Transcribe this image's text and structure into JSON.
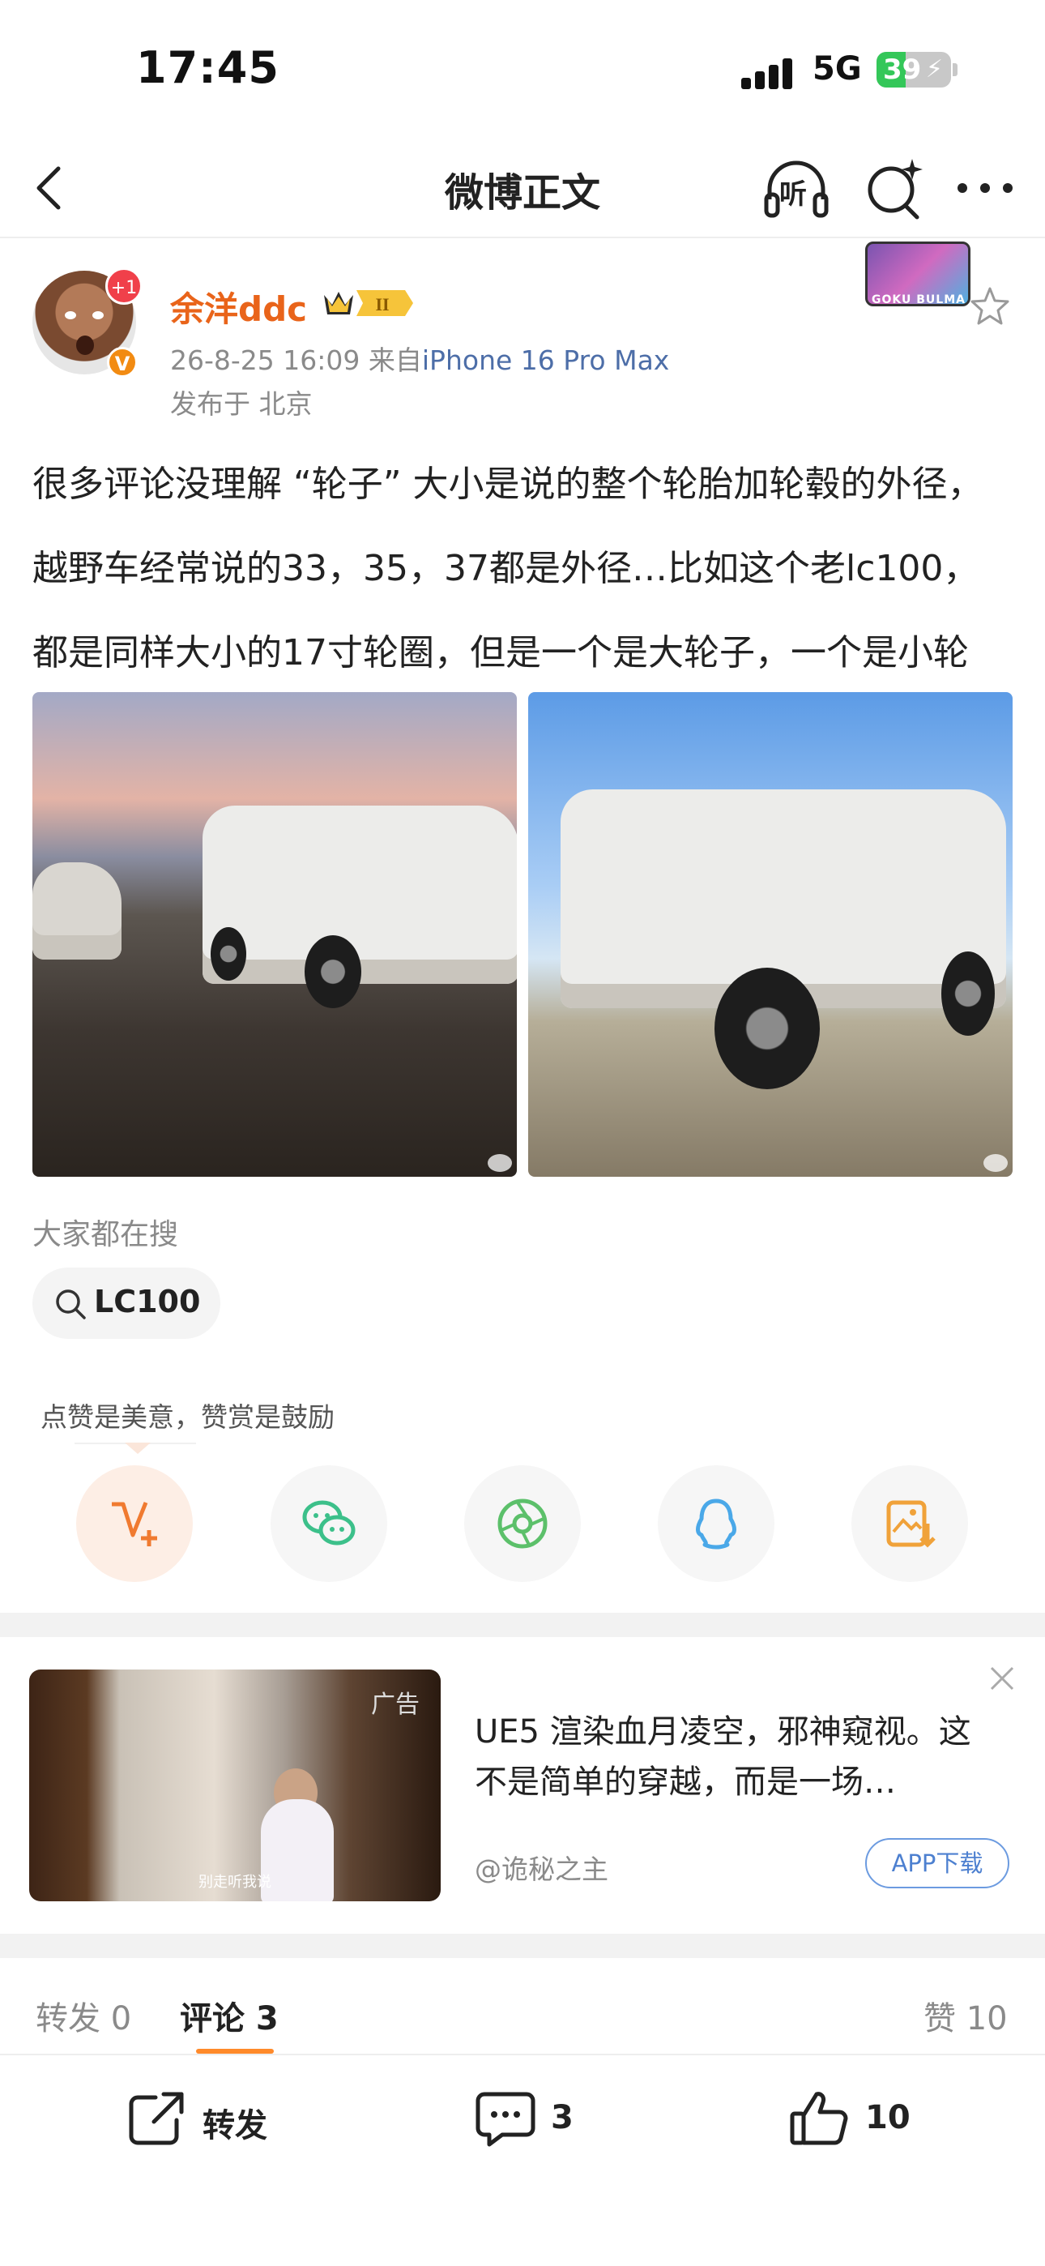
{
  "status_bar": {
    "time": "17:45",
    "network": "5G",
    "battery": "39"
  },
  "nav": {
    "title": "微博正文",
    "listen_label": "听"
  },
  "post": {
    "author": "余洋ddc",
    "vip_level": "II",
    "follow_badge": "+1",
    "verified_badge": "V",
    "timestamp": "26-8-25 16:09",
    "source_prefix": "来自",
    "source": "iPhone 16 Pro Max",
    "location": "发布于 北京",
    "sticker_text": "GOKU BULMA",
    "text": "很多评论没理解 “轮子” 大小是说的整个轮胎加轮毂的外径，越野车经常说的33，35，37都是外径…比如这个老lc100，都是同样大小的17寸轮圈，但是一个是大轮子，一个是小轮子，懂了吗…"
  },
  "search": {
    "label": "大家都在搜",
    "chip": "LC100"
  },
  "share": {
    "tip": "点赞是美意，赞赏是鼓励"
  },
  "ad": {
    "tag": "广告",
    "image_caption": "别走听我说",
    "title": "UE5 渲染血月凌空，邪神窥视。这不是简单的穿越，而是一场…",
    "source": "@诡秘之主",
    "download": "APP下载"
  },
  "tabs": {
    "forward": "转发 0",
    "comments": "评论 3",
    "likes": "赞 10"
  },
  "bottom_bar": {
    "forward": "转发",
    "comments": "3",
    "likes": "10"
  },
  "colors": {
    "accent_orange": "#e9641a",
    "link_blue": "#4d6ea8",
    "wechat_green": "#3cc08a",
    "moments_green": "#5cc06a",
    "qq_blue": "#4aa8e8",
    "save_orange": "#f0a23a"
  },
  "icons": [
    "back-icon",
    "headphones-icon",
    "sparkle-search-icon",
    "more-icon",
    "star-icon",
    "search-icon",
    "reward-v-icon",
    "wechat-icon",
    "moments-icon",
    "qq-icon",
    "save-image-icon",
    "close-icon",
    "share-out-icon",
    "comment-icon",
    "thumbs-up-icon"
  ]
}
